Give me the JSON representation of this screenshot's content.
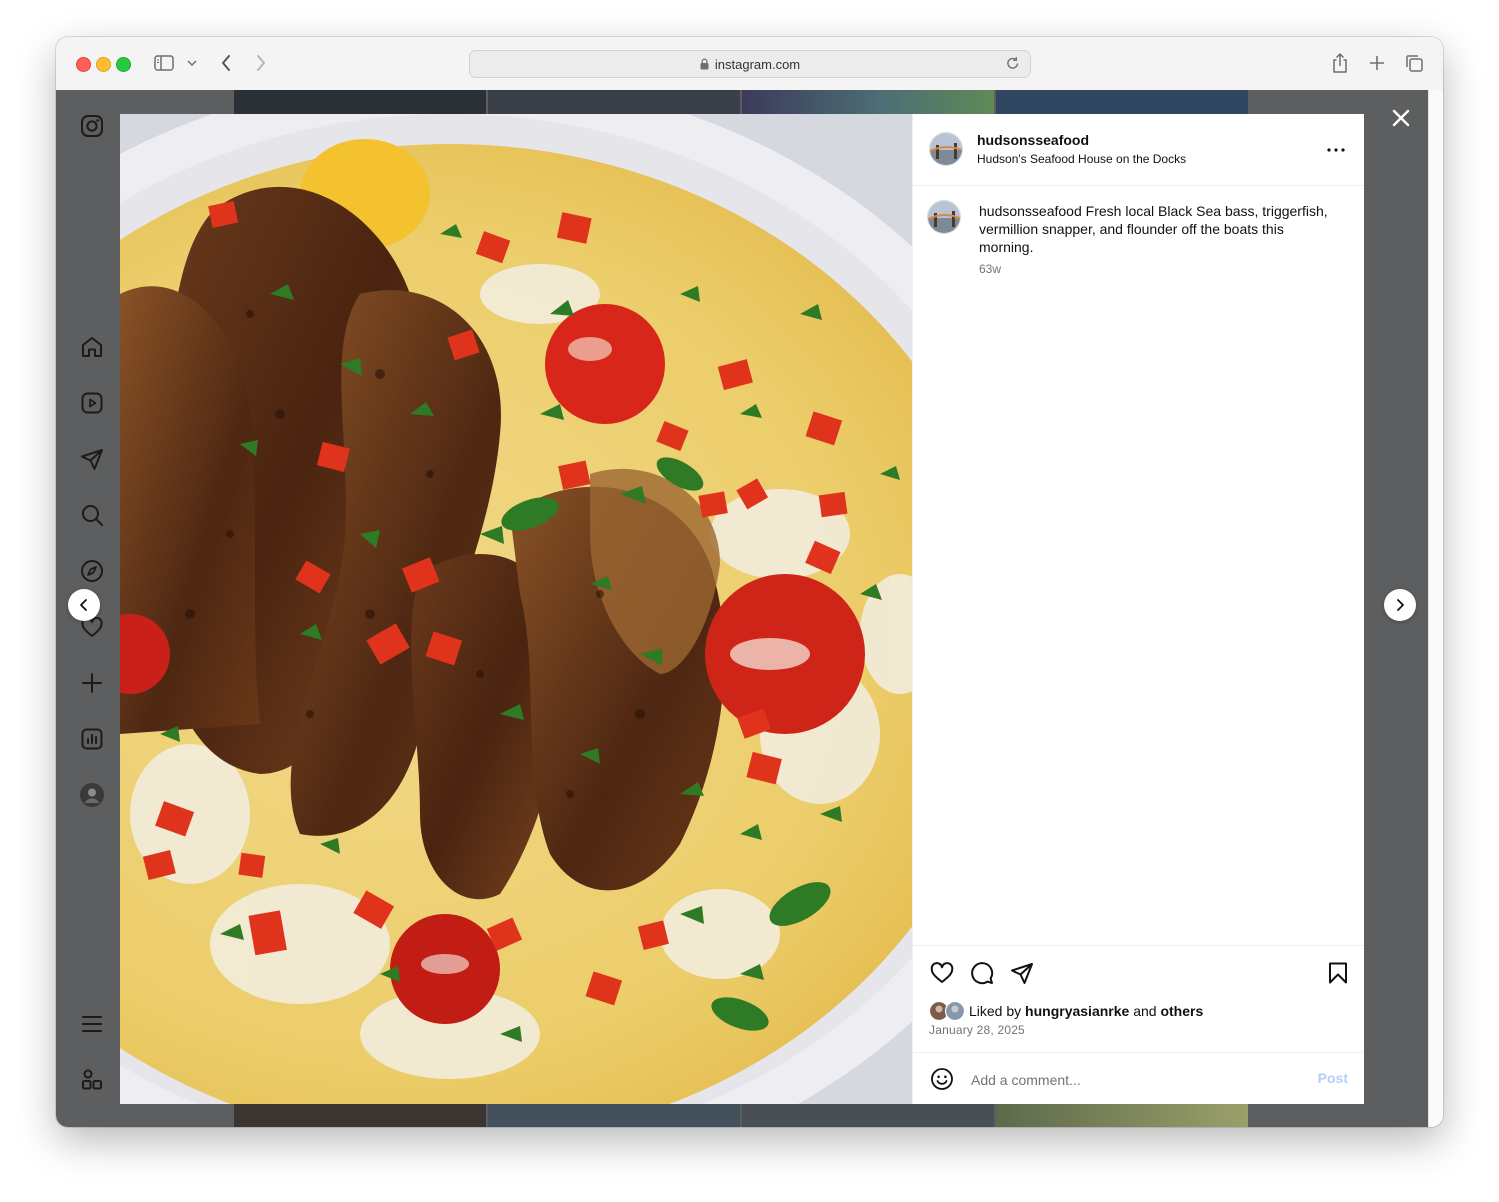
{
  "browser": {
    "url": "instagram.com"
  },
  "post": {
    "username": "hudsonsseafood",
    "location": "Hudson's Seafood House on the Docks",
    "caption_user": "hudsonsseafood",
    "caption_text": " Fresh local Black Sea bass, triggerfish, vermillion snapper, and flounder off the boats this morning.",
    "caption_time": "63w",
    "liked_by_prefix": "Liked by ",
    "liked_by_user": "hungryasianrke",
    "liked_by_and": " and ",
    "liked_by_others": "others",
    "date": "January 28, 2025"
  },
  "comment": {
    "placeholder": "Add a comment...",
    "post_label": "Post"
  },
  "icons": {
    "sidebar": [
      "instagram-logo-icon",
      "home-icon",
      "reels-icon",
      "messages-icon",
      "search-icon",
      "explore-icon",
      "notifications-icon",
      "create-icon",
      "dashboard-icon",
      "profile-avatar",
      "menu-icon",
      "also-from-meta-icon"
    ],
    "actions": [
      "heart-icon",
      "comment-icon",
      "share-icon",
      "bookmark-icon"
    ]
  },
  "colors": {
    "post_button_disabled": "#b2cffb",
    "overlay": "#5c5e60"
  }
}
